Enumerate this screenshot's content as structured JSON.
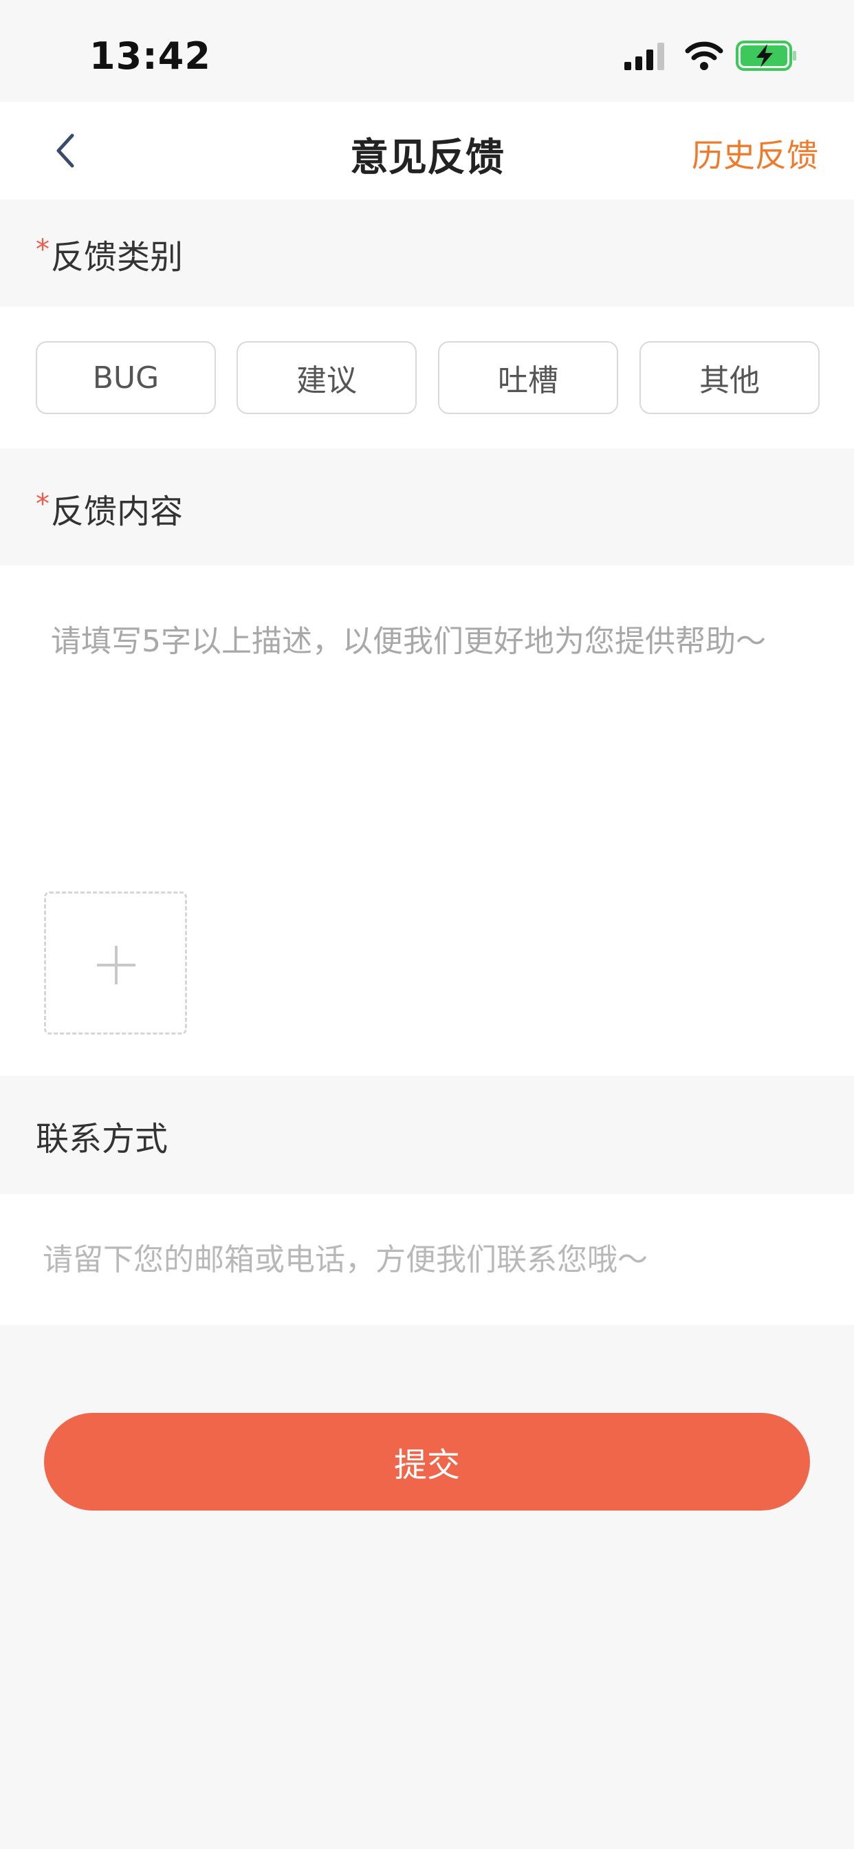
{
  "status_bar": {
    "time": "13:42"
  },
  "nav": {
    "title": "意见反馈",
    "history_label": "历史反馈"
  },
  "category": {
    "label": "反馈类别",
    "required_mark": "*",
    "options": [
      "BUG",
      "建议",
      "吐槽",
      "其他"
    ]
  },
  "content": {
    "label": "反馈内容",
    "required_mark": "*",
    "value": "",
    "placeholder": "请填写5字以上描述，以便我们更好地为您提供帮助～"
  },
  "contact": {
    "label": "联系方式",
    "value": "",
    "placeholder": "请留下您的邮箱或电话，方便我们联系您哦～"
  },
  "submit_label": "提交",
  "colors": {
    "accent": "#f07a2a",
    "submit": "#ef664a",
    "required": "#ee5a4a",
    "battery": "#3cc85a"
  },
  "icons": [
    "signal-icon",
    "wifi-icon",
    "battery-charging-icon",
    "back-arrow-icon",
    "plus-icon"
  ]
}
